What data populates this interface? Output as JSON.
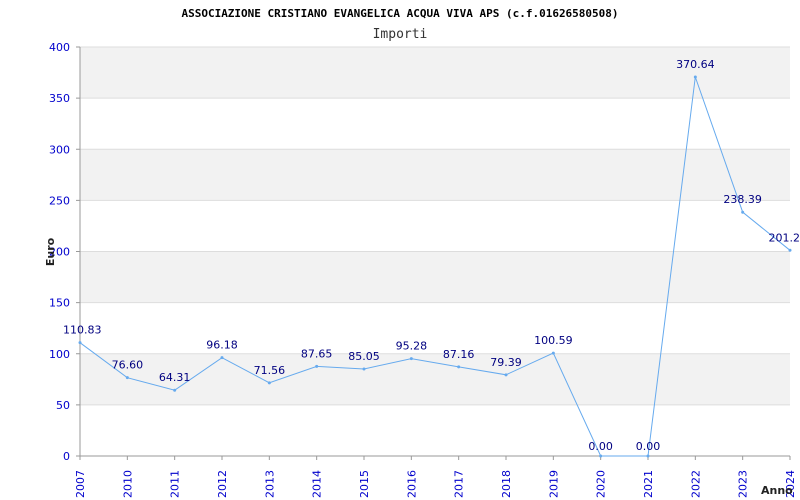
{
  "colors": {
    "band": "#f2f2f2",
    "grid": "#dddddd",
    "line": "#66aaee",
    "axis": "#999999",
    "ticks": "#0000cc",
    "labels": "#000080"
  },
  "chart_data": {
    "type": "line",
    "title": "ASSOCIAZIONE CRISTIANO EVANGELICA ACQUA VIVA APS (c.f.01626580508)",
    "subtitle": "Importi",
    "xlabel": "Anno",
    "ylabel": "Euro",
    "ylim": [
      0,
      400
    ],
    "yticks": [
      0,
      50,
      100,
      150,
      200,
      250,
      300,
      350,
      400
    ],
    "grid": true,
    "x": [
      "2007",
      "2010",
      "2011",
      "2012",
      "2013",
      "2014",
      "2015",
      "2016",
      "2017",
      "2018",
      "2019",
      "2020",
      "2021",
      "2022",
      "2023",
      "2024"
    ],
    "series": [
      {
        "values": [
          110.83,
          76.6,
          64.31,
          96.18,
          71.56,
          87.65,
          85.05,
          95.28,
          87.16,
          79.39,
          100.59,
          0.0,
          0.0,
          370.64,
          238.39,
          201.2
        ],
        "labels": [
          "110.83",
          "76.60",
          "64.31",
          "96.18",
          "71.56",
          "87.65",
          "85.05",
          "95.28",
          "87.16",
          "79.39",
          "100.59",
          "0.00",
          "0.00",
          "370.64",
          "238.39",
          "201.2"
        ]
      }
    ]
  }
}
